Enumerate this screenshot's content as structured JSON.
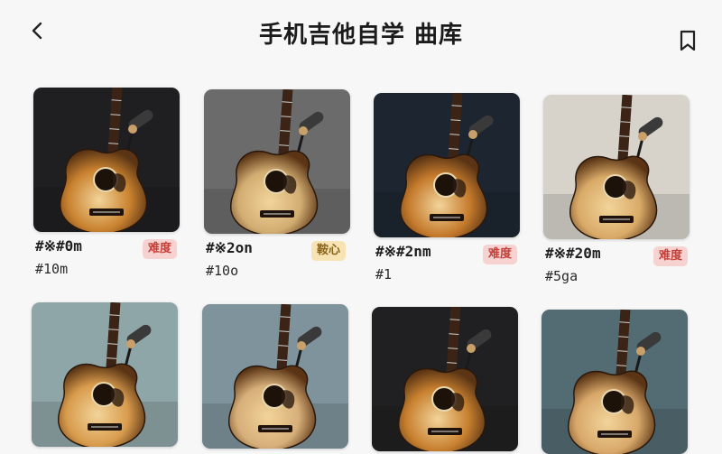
{
  "header": {
    "title": "手机吉他自学 曲库",
    "back_icon": "chevron-left-icon",
    "bookmark_icon": "bookmark-icon"
  },
  "songs": [
    {
      "title": "#※#0m",
      "subtitle": "#10m",
      "badge": "难度",
      "badge_color": "red",
      "bg": "#1f1f22",
      "body": "#c9822f"
    },
    {
      "title": "#※2on",
      "subtitle": "#10o",
      "badge": "鞍心",
      "badge_color": "yellow",
      "bg": "#6b6b6b",
      "body": "#d2ad72"
    },
    {
      "title": "#※#2nm",
      "subtitle": "#1",
      "badge": "难度",
      "badge_color": "red",
      "bg": "#1d2630",
      "body": "#c47a2c"
    },
    {
      "title": "#※#20m",
      "subtitle": "#5ga",
      "badge": "难度",
      "badge_color": "red",
      "bg": "#d7d3cb",
      "body": "#d9aa68"
    },
    {
      "title": "",
      "subtitle": "",
      "badge": "",
      "badge_color": "",
      "bg": "#8fa6a8",
      "body": "#d89b4c"
    },
    {
      "title": "",
      "subtitle": "",
      "badge": "",
      "badge_color": "",
      "bg": "#7e939b",
      "body": "#d6ae79"
    },
    {
      "title": "",
      "subtitle": "",
      "badge": "",
      "badge_color": "",
      "bg": "#202022",
      "body": "#c8802f"
    },
    {
      "title": "",
      "subtitle": "",
      "badge": "",
      "badge_color": "",
      "bg": "#536b72",
      "body": "#d8a86a"
    }
  ],
  "colors": {
    "badge_red_bg": "#f6d3d1",
    "badge_red_text": "#c2403a",
    "badge_yellow_bg": "#f7e3b4",
    "badge_yellow_text": "#8a6418"
  }
}
